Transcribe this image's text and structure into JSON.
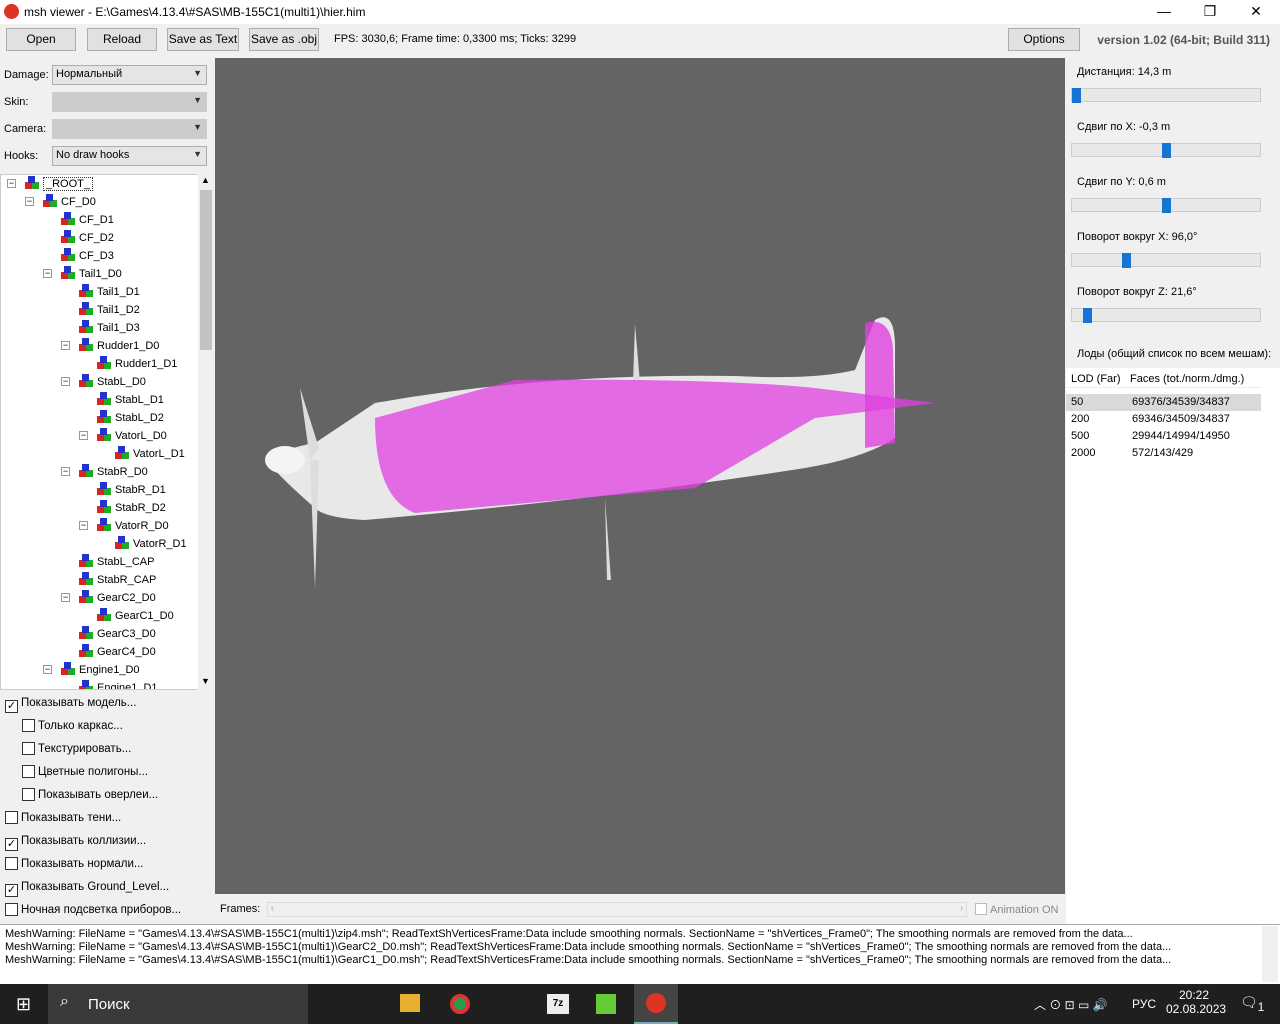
{
  "window": {
    "title": "msh viewer - E:\\Games\\4.13.4\\#SAS\\MB-155C1(multi1)\\hier.him",
    "minimize": "—",
    "maximize": "❐",
    "close": "✕"
  },
  "toolbar": {
    "open": "Open",
    "reload": "Reload",
    "save_text": "Save as Text",
    "save_obj": "Save as .obj",
    "fps": "FPS: 3030,6; Frame time: 0,3300 ms; Ticks: 3299",
    "options": "Options",
    "version": "version 1.02 (64-bit; Build 311)"
  },
  "left": {
    "damage_label": "Damage:",
    "damage_value": "Нормальный",
    "skin_label": "Skin:",
    "camera_label": "Camera:",
    "hooks_label": "Hooks:",
    "hooks_value": "No draw hooks",
    "tree": [
      {
        "label": "_ROOT_",
        "depth": 0,
        "exp": "-"
      },
      {
        "label": "CF_D0",
        "depth": 1,
        "exp": "-"
      },
      {
        "label": "CF_D1",
        "depth": 2
      },
      {
        "label": "CF_D2",
        "depth": 2
      },
      {
        "label": "CF_D3",
        "depth": 2
      },
      {
        "label": "Tail1_D0",
        "depth": 2,
        "exp": "-"
      },
      {
        "label": "Tail1_D1",
        "depth": 3
      },
      {
        "label": "Tail1_D2",
        "depth": 3
      },
      {
        "label": "Tail1_D3",
        "depth": 3
      },
      {
        "label": "Rudder1_D0",
        "depth": 3,
        "exp": "-"
      },
      {
        "label": "Rudder1_D1",
        "depth": 4
      },
      {
        "label": "StabL_D0",
        "depth": 3,
        "exp": "-"
      },
      {
        "label": "StabL_D1",
        "depth": 4
      },
      {
        "label": "StabL_D2",
        "depth": 4
      },
      {
        "label": "VatorL_D0",
        "depth": 4,
        "exp": "-"
      },
      {
        "label": "VatorL_D1",
        "depth": 5
      },
      {
        "label": "StabR_D0",
        "depth": 3,
        "exp": "-"
      },
      {
        "label": "StabR_D1",
        "depth": 4
      },
      {
        "label": "StabR_D2",
        "depth": 4
      },
      {
        "label": "VatorR_D0",
        "depth": 4,
        "exp": "-"
      },
      {
        "label": "VatorR_D1",
        "depth": 5
      },
      {
        "label": "StabL_CAP",
        "depth": 3
      },
      {
        "label": "StabR_CAP",
        "depth": 3
      },
      {
        "label": "GearC2_D0",
        "depth": 3,
        "exp": "-"
      },
      {
        "label": "GearC1_D0",
        "depth": 4
      },
      {
        "label": "GearC3_D0",
        "depth": 3
      },
      {
        "label": "GearC4_D0",
        "depth": 3
      },
      {
        "label": "Engine1_D0",
        "depth": 2,
        "exp": "-"
      },
      {
        "label": "Engine1_D1",
        "depth": 3
      }
    ],
    "checks": [
      {
        "label": "Показывать модель...",
        "checked": true,
        "indent": 0
      },
      {
        "label": "Только каркас...",
        "checked": false,
        "indent": 1
      },
      {
        "label": "Текстурировать...",
        "checked": false,
        "indent": 1
      },
      {
        "label": "Цветные полигоны...",
        "checked": false,
        "indent": 1
      },
      {
        "label": "Показывать оверлеи...",
        "checked": false,
        "indent": 1
      },
      {
        "label": "Показывать тени...",
        "checked": false,
        "indent": 0
      },
      {
        "label": "Показывать коллизии...",
        "checked": true,
        "indent": 0
      },
      {
        "label": "Показывать нормали...",
        "checked": false,
        "indent": 0
      },
      {
        "label": "Показывать Ground_Level...",
        "checked": true,
        "indent": 0
      },
      {
        "label": "Ночная подсветка приборов...",
        "checked": false,
        "indent": 0
      }
    ]
  },
  "frames": {
    "label": "Frames:",
    "animation": "Animation ON"
  },
  "right": {
    "sliders": [
      {
        "label": "Дистанция:  14,3 m",
        "fraction": 0.0
      },
      {
        "label": "Сдвиг по X:  -0,3 m",
        "fraction": 0.5
      },
      {
        "label": "Сдвиг по Y:  0,6 m",
        "fraction": 0.5
      },
      {
        "label": "Поворот вокруг X:  96,0°",
        "fraction": 0.28
      },
      {
        "label": "Поворот вокруг Z:  21,6°",
        "fraction": 0.06
      }
    ],
    "lods_title": "Лоды (общий список по всем мешам):",
    "lod_headers": [
      "LOD (Far)",
      "Faces (tot./norm./dmg.)"
    ],
    "lods": [
      [
        "50",
        "69376/34539/34837"
      ],
      [
        "200",
        "69346/34509/34837"
      ],
      [
        "500",
        "29944/14994/14950"
      ],
      [
        "2000",
        "572/143/429"
      ]
    ]
  },
  "log": [
    "MeshWarning: FileName = \"Games\\4.13.4\\#SAS\\MB-155C1(multi1)\\zip4.msh\"; ReadTextShVerticesFrame:Data include smoothing normals. SectionName = \"shVertices_Frame0\"; The smoothing normals are removed from the data...",
    "MeshWarning: FileName = \"Games\\4.13.4\\#SAS\\MB-155C1(multi1)\\GearC2_D0.msh\"; ReadTextShVerticesFrame:Data include smoothing normals. SectionName = \"shVertices_Frame0\"; The smoothing normals are removed from the data...",
    "MeshWarning: FileName = \"Games\\4.13.4\\#SAS\\MB-155C1(multi1)\\GearC1_D0.msh\"; ReadTextShVerticesFrame:Data include smoothing normals. SectionName = \"shVertices_Frame0\"; The smoothing normals are removed from the data..."
  ],
  "taskbar": {
    "search": "Поиск",
    "lang": "РУС",
    "time": "20:22",
    "date": "02.08.2023",
    "notif": "1"
  }
}
